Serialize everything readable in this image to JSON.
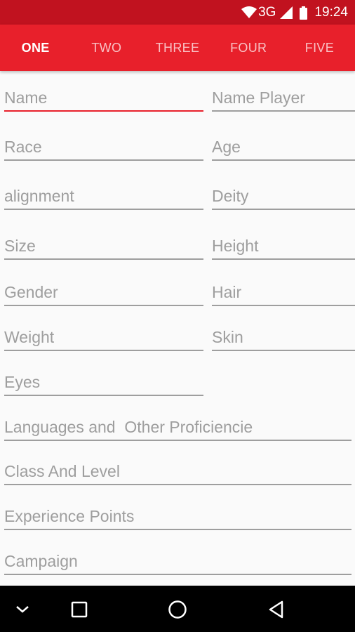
{
  "status_bar": {
    "network": "3G",
    "time": "19:24",
    "bg_color": "#c1121f",
    "icons": [
      "wifi-icon",
      "cell-signal-icon",
      "battery-icon"
    ]
  },
  "tabs": [
    {
      "label": "ONE",
      "active": true
    },
    {
      "label": "TWO",
      "active": false
    },
    {
      "label": "THREE",
      "active": false
    },
    {
      "label": "FOUR",
      "active": false
    },
    {
      "label": "FIVE",
      "active": false
    }
  ],
  "accent_color": "#e8202b",
  "form": {
    "name": {
      "placeholder": "Name"
    },
    "name_player": {
      "placeholder": "Name Player"
    },
    "race": {
      "placeholder": "Race"
    },
    "age": {
      "placeholder": "Age"
    },
    "alignment": {
      "placeholder": "alignment"
    },
    "deity": {
      "placeholder": "Deity"
    },
    "size": {
      "placeholder": "Size"
    },
    "height": {
      "placeholder": "Height"
    },
    "gender": {
      "placeholder": "Gender"
    },
    "hair": {
      "placeholder": "Hair"
    },
    "weight": {
      "placeholder": "Weight"
    },
    "skin": {
      "placeholder": "Skin"
    },
    "eyes": {
      "placeholder": "Eyes"
    },
    "languages": {
      "placeholder": "Languages and  Other Proficiencie"
    },
    "class_level": {
      "placeholder": "Class And Level"
    },
    "experience": {
      "placeholder": "Experience Points"
    },
    "campaign": {
      "placeholder": "Campaign"
    }
  },
  "nav_bar": {
    "icons": [
      "chevron-down-icon",
      "recents-square-icon",
      "home-circle-icon",
      "back-triangle-icon"
    ]
  }
}
